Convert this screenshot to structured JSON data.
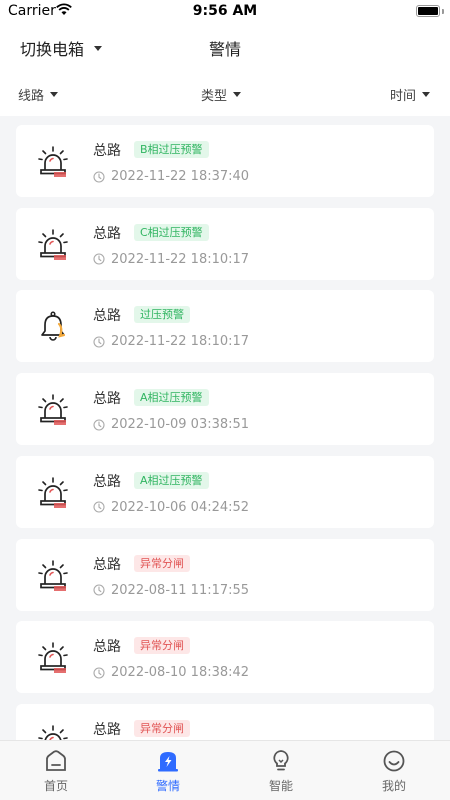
{
  "status_bar": {
    "carrier": "Carrier",
    "time": "9:56 AM"
  },
  "nav": {
    "switch_label": "切换电箱",
    "title": "警情"
  },
  "filters": {
    "line": "线路",
    "type": "类型",
    "time": "时间"
  },
  "colors": {
    "accent": "#2f6bff",
    "alarm_red": "#e15656",
    "warn_green": "#31b561",
    "bell_orange": "#f3a93c"
  },
  "alerts": [
    {
      "name": "总路",
      "tag": "B相过压预警",
      "tag_color": "green",
      "icon": "siren-icon",
      "time": "2022-11-22 18:37:40"
    },
    {
      "name": "总路",
      "tag": "C相过压预警",
      "tag_color": "green",
      "icon": "siren-icon",
      "time": "2022-11-22 18:10:17"
    },
    {
      "name": "总路",
      "tag": "过压预警",
      "tag_color": "green",
      "icon": "bell-icon",
      "time": "2022-11-22 18:10:17"
    },
    {
      "name": "总路",
      "tag": "A相过压预警",
      "tag_color": "green",
      "icon": "siren-icon",
      "time": "2022-10-09 03:38:51"
    },
    {
      "name": "总路",
      "tag": "A相过压预警",
      "tag_color": "green",
      "icon": "siren-icon",
      "time": "2022-10-06 04:24:52"
    },
    {
      "name": "总路",
      "tag": "异常分闸",
      "tag_color": "red",
      "icon": "siren-icon",
      "time": "2022-08-11 11:17:55"
    },
    {
      "name": "总路",
      "tag": "异常分闸",
      "tag_color": "red",
      "icon": "siren-icon",
      "time": "2022-08-10 18:38:42"
    },
    {
      "name": "总路",
      "tag": "异常分闸",
      "tag_color": "red",
      "icon": "siren-icon",
      "time": ""
    }
  ],
  "tabs": [
    {
      "label": "首页",
      "icon": "home-icon",
      "active": false
    },
    {
      "label": "警情",
      "icon": "alarm-icon",
      "active": true
    },
    {
      "label": "智能",
      "icon": "bulb-icon",
      "active": false
    },
    {
      "label": "我的",
      "icon": "profile-icon",
      "active": false
    }
  ]
}
